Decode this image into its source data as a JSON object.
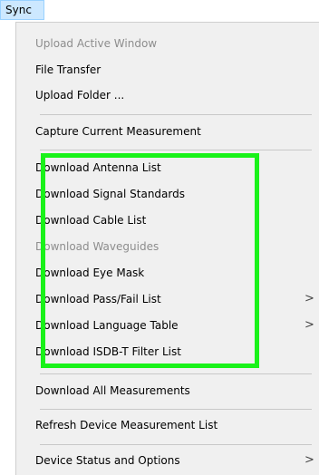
{
  "menubar": {
    "sync_label": "Sync"
  },
  "menu": {
    "items": [
      {
        "label": "Upload Active Window",
        "disabled": true
      },
      {
        "label": "File Transfer"
      },
      {
        "label": "Upload Folder ..."
      },
      {
        "label": "Capture Current Measurement"
      },
      {
        "label": "Download Antenna List"
      },
      {
        "label": "Download Signal Standards"
      },
      {
        "label": "Download Cable List"
      },
      {
        "label": "Download Waveguides",
        "disabled": true
      },
      {
        "label": "Download Eye Mask"
      },
      {
        "label": "Download Pass/Fail List",
        "submenu": true
      },
      {
        "label": "Download Language Table",
        "submenu": true
      },
      {
        "label": "Download ISDB-T Filter List"
      },
      {
        "label": "Download All Measurements"
      },
      {
        "label": "Refresh Device Measurement List"
      },
      {
        "label": "Device Status and Options",
        "submenu": true
      }
    ],
    "submenu_arrow": ">"
  },
  "colors": {
    "highlight": "#19f219",
    "menubar_active": "#cce8ff",
    "disabled_text": "#8d8d8d",
    "menu_background": "#f0f0f0"
  }
}
